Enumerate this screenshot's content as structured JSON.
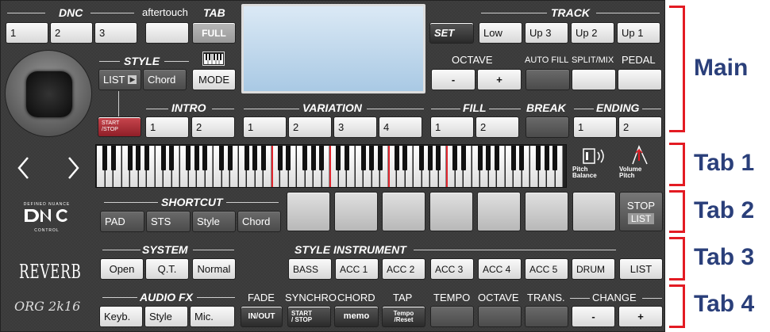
{
  "dnc": {
    "label": "DNC",
    "buttons": [
      "1",
      "2",
      "3"
    ]
  },
  "aftertouch": {
    "label": "aftertouch"
  },
  "tab": {
    "label": "TAB",
    "full": "FULL"
  },
  "track": {
    "label": "TRACK",
    "set": "SET",
    "buttons": [
      "Low",
      "Up 3",
      "Up 2",
      "Up 1"
    ]
  },
  "octave": {
    "label": "OCTAVE",
    "minus": "-",
    "plus": "+"
  },
  "autofill": {
    "label": "AUTO FILL"
  },
  "splitmix": {
    "label": "SPLIT/MIX"
  },
  "pedal": {
    "label": "PEDAL"
  },
  "style": {
    "label": "STYLE",
    "list": "LIST",
    "chord": "Chord",
    "mode": "MODE"
  },
  "startstop": {
    "line1": "START",
    "line2": "/STOP"
  },
  "intro": {
    "label": "INTRO",
    "buttons": [
      "1",
      "2"
    ]
  },
  "variation": {
    "label": "VARIATION",
    "buttons": [
      "1",
      "2",
      "3",
      "4"
    ]
  },
  "fill": {
    "label": "FILL",
    "buttons": [
      "1",
      "2"
    ]
  },
  "break": {
    "label": "BREAK"
  },
  "ending": {
    "label": "ENDING",
    "buttons": [
      "1",
      "2"
    ]
  },
  "pitch": {
    "line1": "Pitch",
    "line2": "Balance"
  },
  "volume": {
    "line1": "Volume",
    "line2": "Pitch"
  },
  "logo": {
    "top": "DEFINED NUANCE",
    "bottom": "CONTROL"
  },
  "shortcut": {
    "label": "SHORTCUT",
    "buttons": [
      "PAD",
      "STS",
      "Style",
      "Chord"
    ]
  },
  "stoplist": {
    "stop": "STOP",
    "list": "LIST"
  },
  "reverb": {
    "label": "REVERB"
  },
  "system": {
    "label": "SYSTEM",
    "buttons": [
      "Open",
      "Q.T.",
      "Normal"
    ]
  },
  "styleinstrument": {
    "label": "STYLE INSTRUMENT",
    "buttons": [
      "BASS",
      "ACC 1",
      "ACC 2",
      "ACC 3",
      "ACC 4",
      "ACC 5",
      "DRUM"
    ],
    "list": "LIST"
  },
  "brand": {
    "label": "ORG 2k16"
  },
  "audiofx": {
    "label": "AUDIO FX",
    "buttons": [
      "Keyb.",
      "Style",
      "Mic."
    ]
  },
  "fade": {
    "label": "FADE",
    "btn": "IN/OUT"
  },
  "synchro": {
    "label": "SYNCHRO",
    "line1": "START",
    "line2": "/ STOP"
  },
  "chordmemo": {
    "label": "CHORD",
    "btn": "memo"
  },
  "tap": {
    "label": "TAP",
    "line1": "Tempo",
    "line2": "/Reset"
  },
  "tempo": {
    "label": "TEMPO"
  },
  "octave2": {
    "label": "OCTAVE"
  },
  "trans": {
    "label": "TRANS."
  },
  "change": {
    "label": "CHANGE",
    "minus": "-",
    "plus": "+"
  },
  "tabs": {
    "main": "Main",
    "tab1": "Tab 1",
    "tab2": "Tab 2",
    "tab3": "Tab 3",
    "tab4": "Tab 4"
  },
  "colors": {
    "accent": "#e31b23",
    "tabtext": "#2a3f7a",
    "panel": "#3a3a3a"
  }
}
